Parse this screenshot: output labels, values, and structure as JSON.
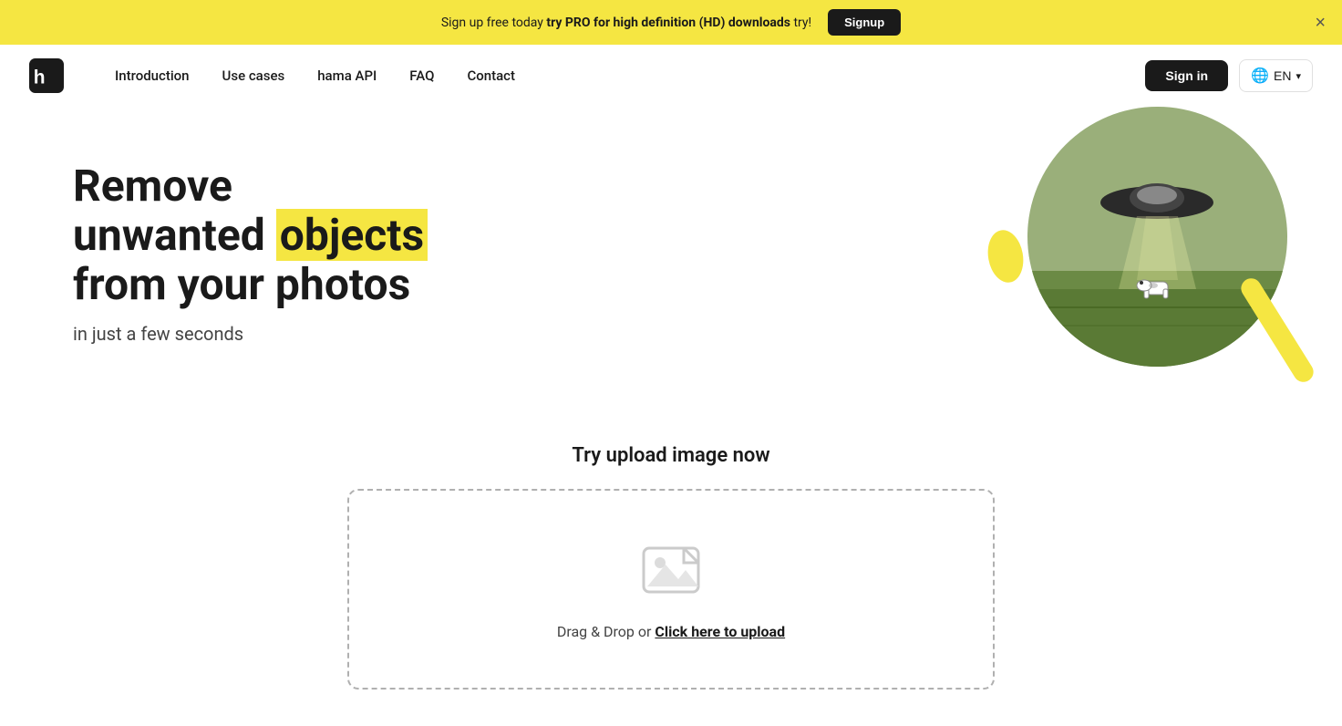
{
  "banner": {
    "prefix": "Sign up free today ",
    "highlight": "try PRO for high definition (HD) downloads",
    "suffix": " try!",
    "signup_label": "Signup",
    "close_label": "×"
  },
  "nav": {
    "logo_alt": "Hama",
    "links": [
      {
        "label": "Introduction",
        "id": "intro"
      },
      {
        "label": "Use cases",
        "id": "use-cases"
      },
      {
        "label": "hama API",
        "id": "api"
      },
      {
        "label": "FAQ",
        "id": "faq"
      },
      {
        "label": "Contact",
        "id": "contact"
      }
    ],
    "sign_in": "Sign in",
    "lang": "EN"
  },
  "hero": {
    "line1": "Remove",
    "line2_plain": "unwanted",
    "line2_highlight": "objects",
    "line3": "from your photos",
    "subtitle": "in just a few seconds"
  },
  "upload": {
    "title": "Try upload image now",
    "drag_prefix": "Drag & Drop or ",
    "click_text": "Click here to upload",
    "drag_suffix": ""
  }
}
